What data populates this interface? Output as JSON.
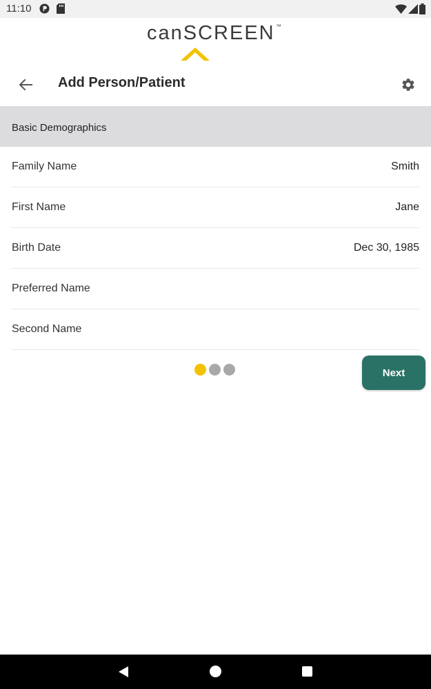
{
  "status_bar": {
    "time": "11:10",
    "icons": [
      "app-notification-icon",
      "sd-card-icon",
      "wifi-icon",
      "cell-signal-icon",
      "battery-icon"
    ]
  },
  "logo": {
    "text": "canSCREEN",
    "trademark": "™",
    "chevron_color": "#f2c200"
  },
  "toolbar": {
    "title": "Add Person/Patient",
    "back_icon": "arrow-left-icon",
    "settings_icon": "gear-icon"
  },
  "section": {
    "title": "Basic Demographics"
  },
  "form": {
    "rows": [
      {
        "label": "Family Name",
        "value": "Smith"
      },
      {
        "label": "First Name",
        "value": "Jane"
      },
      {
        "label": "Birth Date",
        "value": "Dec 30, 1985"
      },
      {
        "label": "Preferred Name",
        "value": ""
      },
      {
        "label": "Second Name",
        "value": ""
      }
    ]
  },
  "pager": {
    "pages": 3,
    "current": 1,
    "active_color": "#f2c200",
    "inactive_color": "#a8a8a8"
  },
  "actions": {
    "next_label": "Next",
    "next_color": "#2a7265"
  },
  "nav_bar": {
    "icons": [
      "nav-back-icon",
      "nav-home-icon",
      "nav-recents-icon"
    ]
  }
}
